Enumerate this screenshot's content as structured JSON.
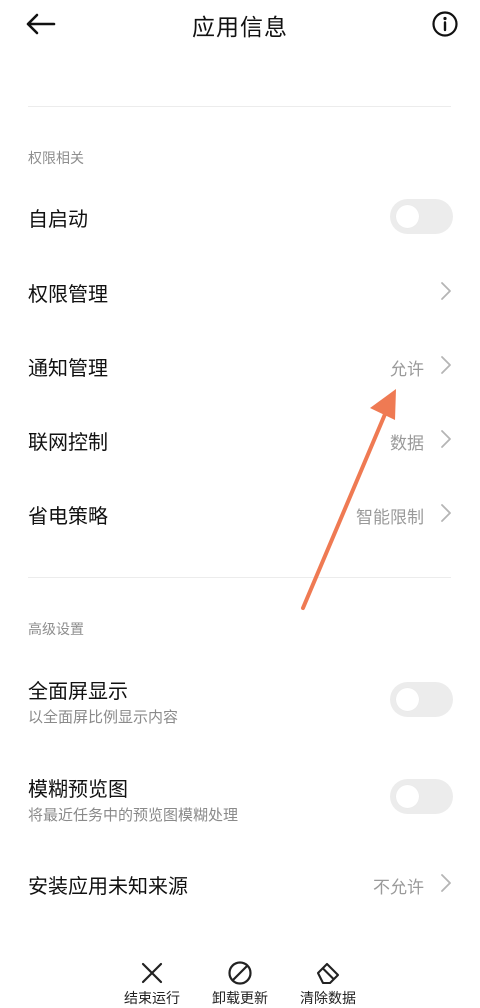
{
  "header": {
    "title": "应用信息",
    "back_icon": "back-arrow-icon",
    "info_icon": "info-icon"
  },
  "sections": [
    {
      "title": "权限相关",
      "rows": [
        {
          "label": "自启动",
          "control": "toggle",
          "on": false
        },
        {
          "label": "权限管理",
          "control": "chevron",
          "value": ""
        },
        {
          "label": "通知管理",
          "control": "chevron",
          "value": "允许"
        },
        {
          "label": "联网控制",
          "control": "chevron",
          "value": "数据"
        },
        {
          "label": "省电策略",
          "control": "chevron",
          "value": "智能限制"
        }
      ]
    },
    {
      "title": "高级设置",
      "rows": [
        {
          "label": "全面屏显示",
          "subtitle": "以全面屏比例显示内容",
          "control": "toggle",
          "on": false
        },
        {
          "label": "模糊预览图",
          "subtitle": "将最近任务中的预览图模糊处理",
          "control": "toggle",
          "on": false
        },
        {
          "label": "安装应用未知来源",
          "control": "chevron",
          "value": "不允许"
        }
      ]
    }
  ],
  "bottom_actions": [
    {
      "label": "结束运行",
      "icon": "close-x-icon"
    },
    {
      "label": "卸载更新",
      "icon": "prohibit-icon"
    },
    {
      "label": "清除数据",
      "icon": "eraser-icon"
    }
  ],
  "colors": {
    "annotation_arrow": "#ef7a53",
    "toggle_off": "#ececec",
    "secondary_text": "#9a9a9a"
  }
}
